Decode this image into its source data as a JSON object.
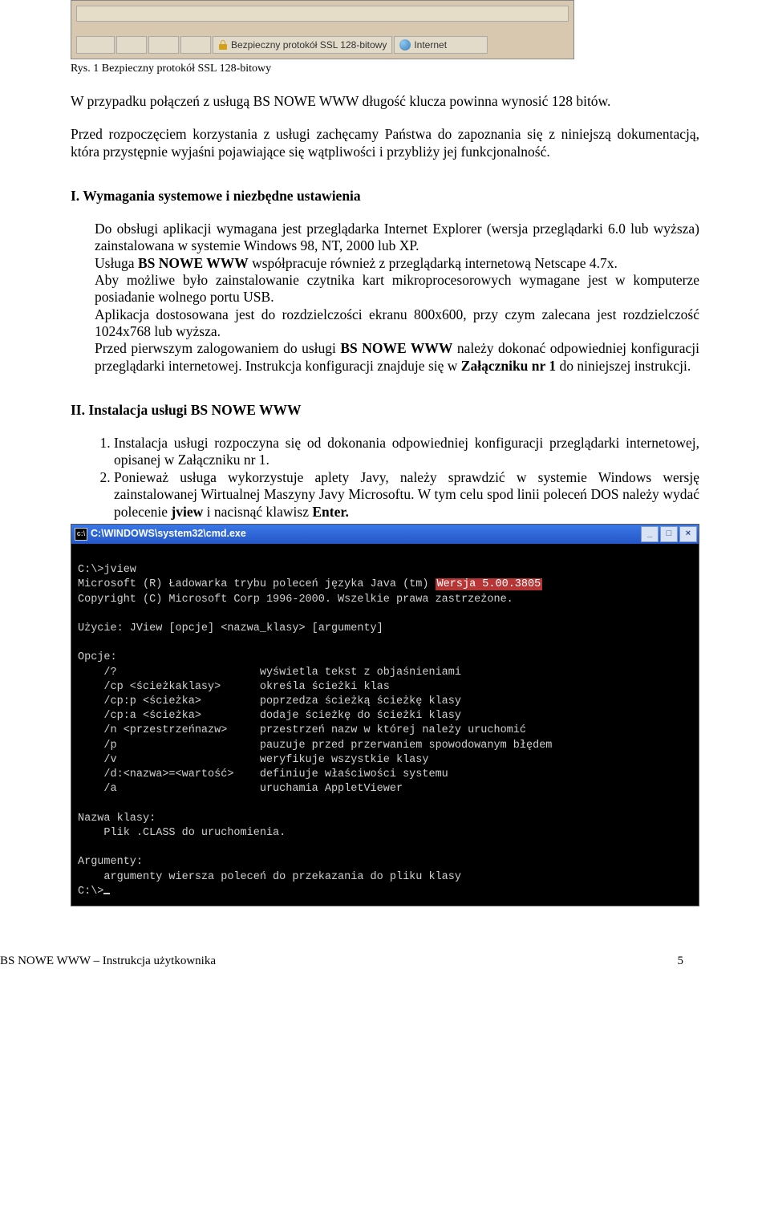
{
  "statusbar": {
    "ssl_label": "Bezpieczny protokół SSL 128-bitowy",
    "internet_label": "Internet"
  },
  "caption": "Rys. 1 Bezpieczny protokół SSL 128-bitowy",
  "para1": "W przypadku połączeń z usługą BS NOWE WWW długość klucza powinna wynosić 128 bitów.",
  "para2": "Przed rozpoczęciem korzystania z usługi zachęcamy Państwa do zapoznania się z niniejszą dokumentacją, która przystępnie wyjaśni pojawiające się wątpliwości i przybliży jej funkcjonalność.",
  "section1": {
    "title": "I.    Wymagania systemowe i niezbędne ustawienia",
    "b1a": "Do obsługi aplikacji wymagana jest przeglądarka Internet Explorer (wersja przeglądarki 6.0 lub wyższa) zainstalowana w systemie Windows 98, NT, 2000 lub XP.",
    "b1b_pre": "Usługa ",
    "b1b_bold": "BS NOWE WWW",
    "b1b_post": " współpracuje również z przeglądarką internetową Netscape 4.7x.",
    "b2": "Aby możliwe było zainstalowanie czytnika kart mikroprocesorowych wymagane jest w komputerze posiadanie wolnego portu USB.",
    "b3": "Aplikacja dostosowana jest do rozdzielczości ekranu 800x600, przy czym zalecana jest rozdzielczość 1024x768 lub wyższa.",
    "b4_pre": "Przed pierwszym zalogowaniem do usługi ",
    "b4_bold": "BS NOWE WWW",
    "b4_mid": " należy dokonać odpowiedniej konfiguracji przeglądarki internetowej. Instrukcja konfiguracji znajduje się w ",
    "b4_bold2": "Załączniku nr 1",
    "b4_post": " do niniejszej instrukcji."
  },
  "section2": {
    "title": "II. Instalacja usługi BS NOWE WWW",
    "li1": "Instalacja usługi rozpoczyna się od dokonania odpowiedniej konfiguracji przeglądarki internetowej, opisanej w Załączniku nr 1.",
    "li2_pre": "Ponieważ usługa wykorzystuje aplety Javy, należy sprawdzić w systemie Windows wersję zainstalowanej Wirtualnej Maszyny Javy Microsoftu. W tym celu spod linii poleceń DOS należy wydać polecenie ",
    "li2_b1": "jview",
    "li2_mid": " i nacisnąć klawisz ",
    "li2_b2": "Enter.",
    "li2_post": ""
  },
  "cmd": {
    "title": "C:\\WINDOWS\\system32\\cmd.exe",
    "line_prompt": "C:\\>",
    "line_cmd": "jview",
    "line_ms_pre": "Microsoft (R) Ładowarka trybu poleceń języka Java (tm) ",
    "line_ms_hi": "Wersja 5.00.3805",
    "line_copy": "Copyright (C) Microsoft Corp 1996-2000. Wszelkie prawa zastrzeżone.",
    "line_usage": "Użycie: JView [opcje] <nazwa_klasy> [argumenty]",
    "opcje_label": "Opcje:",
    "opts": [
      [
        "    /?",
        "wyświetla tekst z objaśnieniami"
      ],
      [
        "    /cp <ścieżkaklasy>",
        "określa ścieżki klas"
      ],
      [
        "    /cp:p <ścieżka>",
        "poprzedza ścieżką ścieżkę klasy"
      ],
      [
        "    /cp:a <ścieżka>",
        "dodaje ścieżkę do ścieżki klasy"
      ],
      [
        "    /n <przestrzeńnazw>",
        "przestrzeń nazw w której należy uruchomić"
      ],
      [
        "    /p",
        "pauzuje przed przerwaniem spowodowanym błędem"
      ],
      [
        "    /v",
        "weryfikuje wszystkie klasy"
      ],
      [
        "    /d:<nazwa>=<wartość>",
        "definiuje właściwości systemu"
      ],
      [
        "    /a",
        "uruchamia AppletViewer"
      ]
    ],
    "klasy_label": "Nazwa klasy:",
    "klasy_line": "    Plik .CLASS do uruchomienia.",
    "arg_label": "Argumenty:",
    "arg_line": "    argumenty wiersza poleceń do przekazania do pliku klasy"
  },
  "footer": {
    "left": "BS NOWE WWW – Instrukcja użytkownika",
    "right": "5"
  }
}
